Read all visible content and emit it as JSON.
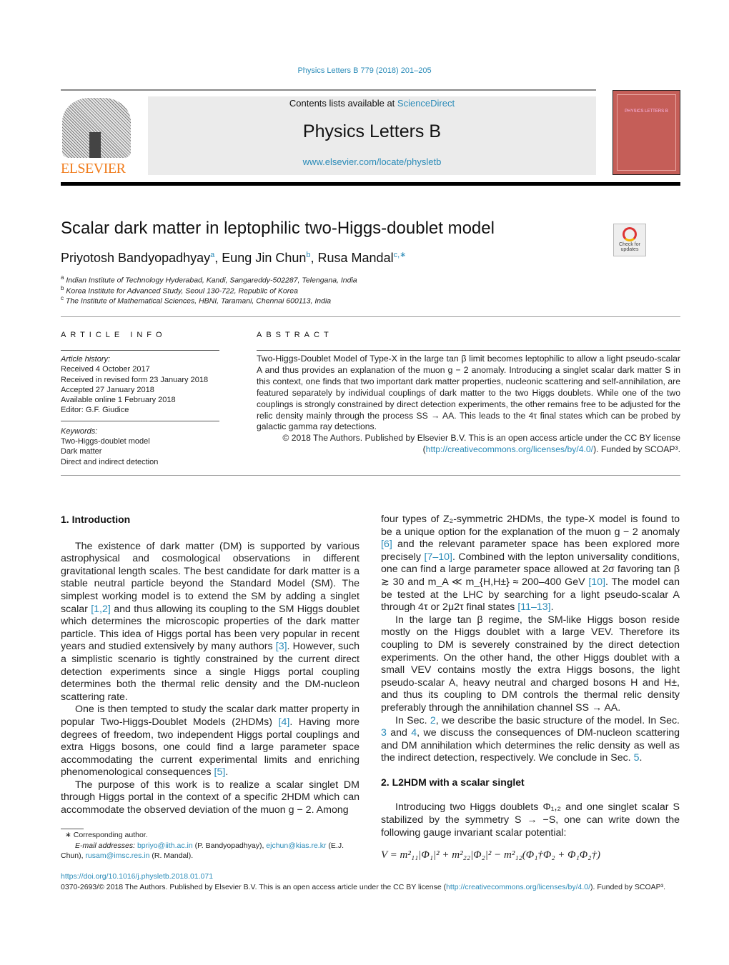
{
  "journal_ref": "Physics Letters B 779 (2018) 201–205",
  "banner": {
    "contents_prefix": "Contents lists available at ",
    "sciencedirect": "ScienceDirect",
    "journal_title": "Physics Letters B",
    "url": "www.elsevier.com/locate/physletb"
  },
  "publisher_logo": "ELSEVIER",
  "cover_title": "PHYSICS LETTERS B",
  "check_updates": "Check for updates",
  "title": "Scalar dark matter in leptophilic two-Higgs-doublet model",
  "authors": [
    {
      "name": "Priyotosh Bandyopadhyay",
      "sup": "a"
    },
    {
      "name": "Eung Jin Chun",
      "sup": "b"
    },
    {
      "name": "Rusa Mandal",
      "sup": "c,∗"
    }
  ],
  "affiliations": [
    {
      "sup": "a",
      "text": "Indian Institute of Technology Hyderabad, Kandi, Sangareddy-502287, Telengana, India"
    },
    {
      "sup": "b",
      "text": "Korea Institute for Advanced Study, Seoul 130-722, Republic of Korea"
    },
    {
      "sup": "c",
      "text": "The Institute of Mathematical Sciences, HBNI, Taramani, Chennai 600113, India"
    }
  ],
  "article_info": {
    "heading": "ARTICLE INFO",
    "history_label": "Article history:",
    "history": [
      "Received 4 October 2017",
      "Received in revised form 23 January 2018",
      "Accepted 27 January 2018",
      "Available online 1 February 2018",
      "Editor: G.F. Giudice"
    ],
    "keywords_label": "Keywords:",
    "keywords": [
      "Two-Higgs-doublet model",
      "Dark matter",
      "Direct and indirect detection"
    ]
  },
  "abstract": {
    "heading": "ABSTRACT",
    "text": "Two-Higgs-Doublet Model of Type-X in the large tan β limit becomes leptophilic to allow a light pseudo-scalar A and thus provides an explanation of the muon g − 2 anomaly. Introducing a singlet scalar dark matter S in this context, one finds that two important dark matter properties, nucleonic scattering and self-annihilation, are featured separately by individual couplings of dark matter to the two Higgs doublets. While one of the two couplings is strongly constrained by direct detection experiments, the other remains free to be adjusted for the relic density mainly through the process SS → AA. This leads to the 4τ final states which can be probed by galactic gamma ray detections.",
    "copyright": "© 2018 The Authors. Published by Elsevier B.V. This is an open access article under the CC BY license (",
    "license_url": "http://creativecommons.org/licenses/by/4.0/",
    "funded": "). Funded by SCOAP³."
  },
  "sections": {
    "s1_title": "1. Introduction",
    "s2_title": "2. L2HDM with a scalar singlet",
    "left": [
      [
        [
          "t",
          "The existence of dark matter (DM) is supported by various astrophysical and cosmological observations in different gravitational length scales. The best candidate for dark matter is a stable neutral particle beyond the Standard Model (SM). The simplest working model is to extend the SM by adding a singlet scalar "
        ],
        [
          "l",
          "[1,2]"
        ],
        [
          "t",
          " and thus allowing its coupling to the SM Higgs doublet which determines the microscopic properties of the dark matter particle. This idea of Higgs portal has been very popular in recent years and studied extensively by many authors "
        ],
        [
          "l",
          "[3]"
        ],
        [
          "t",
          ". However, such a simplistic scenario is tightly constrained by the current direct detection experiments since a single Higgs portal coupling determines both the thermal relic density and the DM-nucleon scattering rate."
        ]
      ],
      [
        [
          "t",
          "One is then tempted to study the scalar dark matter property in popular Two-Higgs-Doublet Models (2HDMs) "
        ],
        [
          "l",
          "[4]"
        ],
        [
          "t",
          ". Having more degrees of freedom, two independent Higgs portal couplings and extra Higgs bosons, one could find a large parameter space accommodating the current experimental limits and enriching phenomenological consequences "
        ],
        [
          "l",
          "[5]"
        ],
        [
          "t",
          "."
        ]
      ],
      [
        [
          "t",
          "The purpose of this work is to realize a scalar singlet DM through Higgs portal in the context of a specific 2HDM which can accommodate the observed deviation of the muon g − 2. Among"
        ]
      ]
    ],
    "right": [
      [
        [
          "t",
          "four types of Z₂-symmetric 2HDMs, the type-X model is found to be a unique option for the explanation of the muon g − 2 anomaly "
        ],
        [
          "l",
          "[6]"
        ],
        [
          "t",
          " and the relevant parameter space has been explored more precisely "
        ],
        [
          "l",
          "[7–10]"
        ],
        [
          "t",
          ". Combined with the lepton universality conditions, one can find a large parameter space allowed at 2σ favoring tan β ≳ 30 and m_A ≪ m_{H,H±} ≈ 200–400 GeV "
        ],
        [
          "l",
          "[10]"
        ],
        [
          "t",
          ". The model can be tested at the LHC by searching for a light pseudo-scalar A through 4τ or 2μ2τ final states "
        ],
        [
          "l",
          "[11–13]"
        ],
        [
          "t",
          "."
        ]
      ],
      [
        [
          "t",
          "In the large tan β regime, the SM-like Higgs boson reside mostly on the Higgs doublet with a large VEV. Therefore its coupling to DM is severely constrained by the direct detection experiments. On the other hand, the other Higgs doublet with a small VEV contains mostly the extra Higgs bosons, the light pseudo-scalar A, heavy neutral and charged bosons H and H±, and thus its coupling to DM controls the thermal relic density preferably through the annihilation channel SS → AA."
        ]
      ],
      [
        [
          "t",
          "In Sec. "
        ],
        [
          "l",
          "2"
        ],
        [
          "t",
          ", we describe the basic structure of the model. In Sec. "
        ],
        [
          "l",
          "3"
        ],
        [
          "t",
          " and "
        ],
        [
          "l",
          "4"
        ],
        [
          "t",
          ", we discuss the consequences of DM-nucleon scattering and DM annihilation which determines the relic density as well as the indirect detection, respectively. We conclude in Sec. "
        ],
        [
          "l",
          "5"
        ],
        [
          "t",
          "."
        ]
      ]
    ],
    "right2": [
      [
        [
          "t",
          "Introducing two Higgs doublets Φ₁,₂ and one singlet scalar S stabilized by the symmetry S → −S, one can write down the following gauge invariant scalar potential:"
        ]
      ]
    ],
    "equation": "V = m²₁₁|Φ₁|² + m²₂₂|Φ₂|² − m²₁₂(Φ₁†Φ₂ + Φ₁Φ₂†)"
  },
  "footnote": {
    "star": "∗",
    "corresponding": "Corresponding author.",
    "email_label": "E-mail addresses:",
    "emails": [
      {
        "addr": "bpriyo@iith.ac.in",
        "who": " (P. Bandyopadhyay), "
      },
      {
        "addr": "ejchun@kias.re.kr",
        "who": " (E.J. Chun), "
      },
      {
        "addr": "rusam@imsc.res.in",
        "who": " (R. Mandal)."
      }
    ]
  },
  "doi": "https://doi.org/10.1016/j.physletb.2018.01.071",
  "issn_line": "0370-2693/© 2018 The Authors. Published by Elsevier B.V. This is an open access article under the CC BY license (",
  "issn_url": "http://creativecommons.org/licenses/by/4.0/",
  "issn_end": "). Funded by SCOAP³.",
  "colors": {
    "link": "#2a8bb8",
    "elsevier_orange": "#f07c1c",
    "cover": "#c55e58",
    "banner": "#ebebeb"
  }
}
